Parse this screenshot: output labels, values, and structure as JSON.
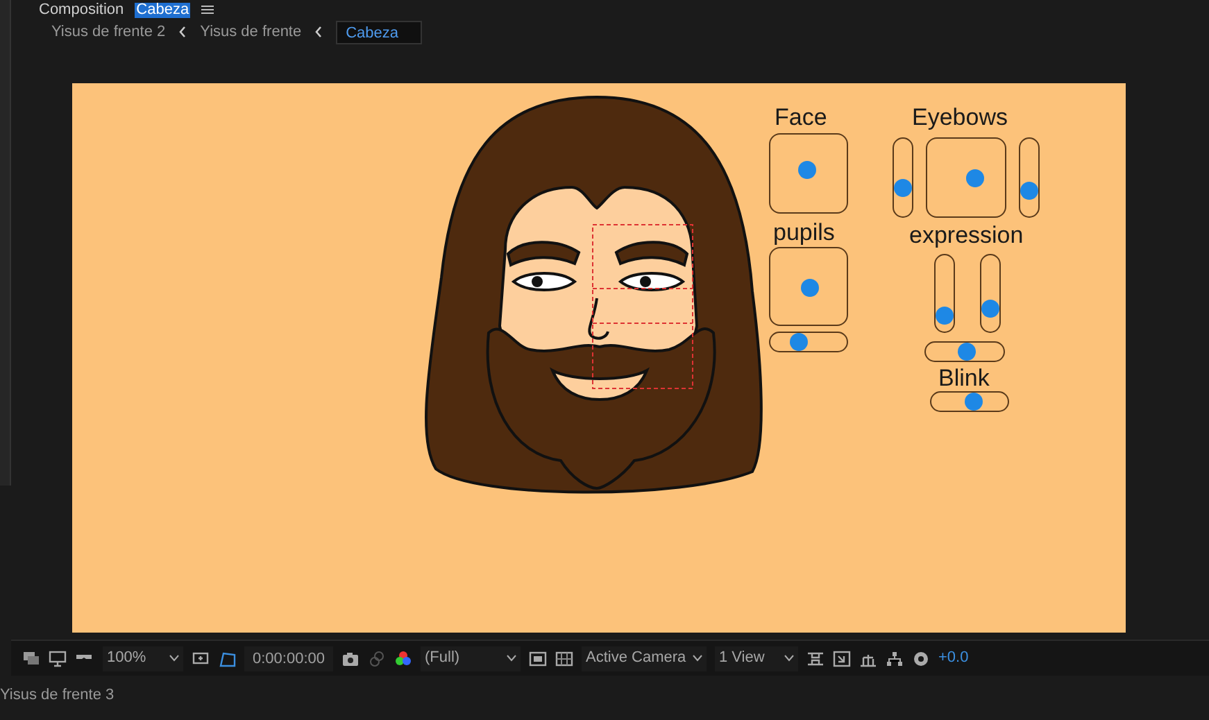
{
  "panel_tab": {
    "title": "Composition",
    "name": "Cabeza"
  },
  "breadcrumbs": [
    {
      "label": "Yisus de frente 2",
      "selected": false
    },
    {
      "label": "Yisus de frente",
      "selected": false
    },
    {
      "label": "Cabeza",
      "selected": true
    }
  ],
  "rig": {
    "labels": [
      "Face",
      "pupils",
      "Eyebows",
      "expression",
      "Blink"
    ],
    "controls": [
      {
        "kind": "pad"
      },
      {
        "kind": "pad"
      },
      {
        "kind": "hslider",
        "level": 0.35
      },
      {
        "kind": "vslider",
        "level": 0.32
      },
      {
        "kind": "pad"
      },
      {
        "kind": "vslider",
        "level": 0.27
      },
      {
        "kind": "vslider",
        "level": 0.09
      },
      {
        "kind": "vslider",
        "level": 0.21
      },
      {
        "kind": "hslider",
        "level": 0.55
      },
      {
        "kind": "hslider",
        "level": 0.58
      }
    ]
  },
  "toolbar": {
    "zoom": "100%",
    "timecode": "0:00:00:00",
    "resolution": "(Full)",
    "camera": "Active Camera",
    "views": "1 View",
    "exposure": "+0.0"
  },
  "status_bar": {
    "text": "Yisus de frente 3"
  }
}
